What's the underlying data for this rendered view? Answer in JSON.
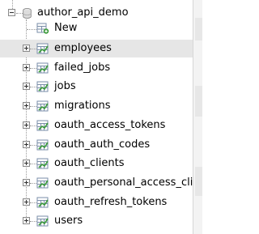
{
  "database": {
    "name": "author_api_demo",
    "icon": "database-icon"
  },
  "new_item": {
    "label": "New",
    "icon": "new-table-icon"
  },
  "tables": [
    {
      "name": "employees",
      "hovered": true
    },
    {
      "name": "failed_jobs"
    },
    {
      "name": "jobs"
    },
    {
      "name": "migrations"
    },
    {
      "name": "oauth_access_tokens"
    },
    {
      "name": "oauth_auth_codes"
    },
    {
      "name": "oauth_clients"
    },
    {
      "name": "oauth_personal_access_clie"
    },
    {
      "name": "oauth_refresh_tokens"
    },
    {
      "name": "users"
    }
  ],
  "icons": {
    "expand": "plus-expand-icon",
    "collapse": "minus-collapse-icon",
    "table": "table-icon"
  },
  "colors": {
    "hover_row": "#e6e6e6",
    "tree_line": "#9a9a9a",
    "table_icon_green": "#3a9a3a"
  }
}
